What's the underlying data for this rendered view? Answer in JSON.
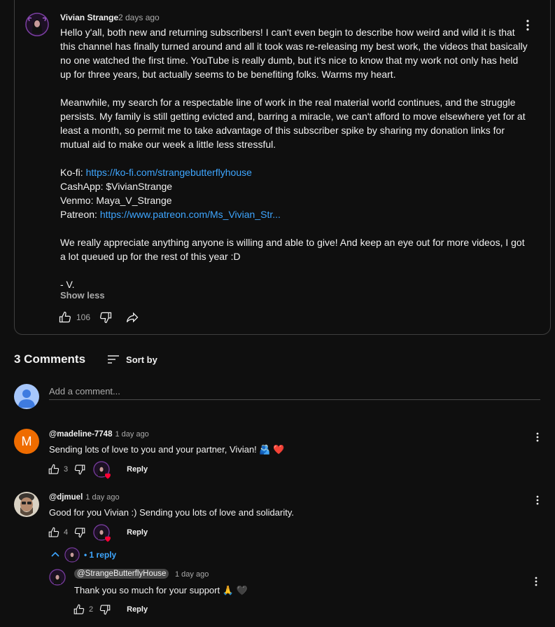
{
  "post": {
    "author": "Vivian Strange",
    "time": "2 days ago",
    "paragraphs": [
      "Hello y'all, both new and returning subscribers! I can't even begin to describe how weird and wild it is that this channel has finally turned around and all it took was re-releasing my best work, the videos that basically no one watched the first time. YouTube is really dumb, but it's nice to know that my work not only has held up for three years, but actually seems to be benefiting folks. Warms my heart.",
      "Meanwhile, my search for a respectable line of work in the real material world continues, and the struggle persists. My family is still getting evicted and, barring a miracle, we can't afford to move elsewhere yet for at least a month, so permit me to take advantage of this subscriber spike by sharing my donation links for mutual aid to make our week a little less stressful."
    ],
    "kofi_label": "Ko-fi: ",
    "kofi_link": "https://ko-fi.com/strangebutterflyhouse",
    "cashapp": "CashApp: $VivianStrange",
    "venmo": "Venmo: Maya_V_Strange",
    "patreon_label": "Patreon: ",
    "patreon_link": "https://www.patreon.com/Ms_Vivian_Str...",
    "closing": "We really appreciate anything anyone is willing and able to give! And keep an eye out for more videos, I got a lot queued up for the rest of this year :D",
    "signature": "- V.",
    "show_less": "Show less",
    "likes": "106"
  },
  "comments_header": {
    "count_label": "3 Comments",
    "sort_label": "Sort by"
  },
  "add_comment": {
    "placeholder": "Add a comment..."
  },
  "comments": [
    {
      "author": "@madeline-7748",
      "time": "1 day ago",
      "text": "Sending lots of love to you and your partner, Vivian! 🫂 ❤️",
      "likes": "3",
      "avatar_letter": "M",
      "reply_label": "Reply"
    },
    {
      "author": "@djmuel",
      "time": "1 day ago",
      "text": "Good for you Vivian :) Sending you lots of love and solidarity.",
      "likes": "4",
      "reply_label": "Reply"
    }
  ],
  "replies_toggle": {
    "label": "• 1 reply"
  },
  "reply": {
    "author": "@StrangeButterflyHouse",
    "time": "1 day ago",
    "text": "Thank you so much for your support 🙏 🖤",
    "likes": "2",
    "reply_label": "Reply"
  },
  "colors": {
    "background": "#0f0f0f",
    "link": "#3ea6ff",
    "muted": "#aaaaaa",
    "madeline_avatar": "#ef6c00",
    "heart": "#ff0033"
  }
}
